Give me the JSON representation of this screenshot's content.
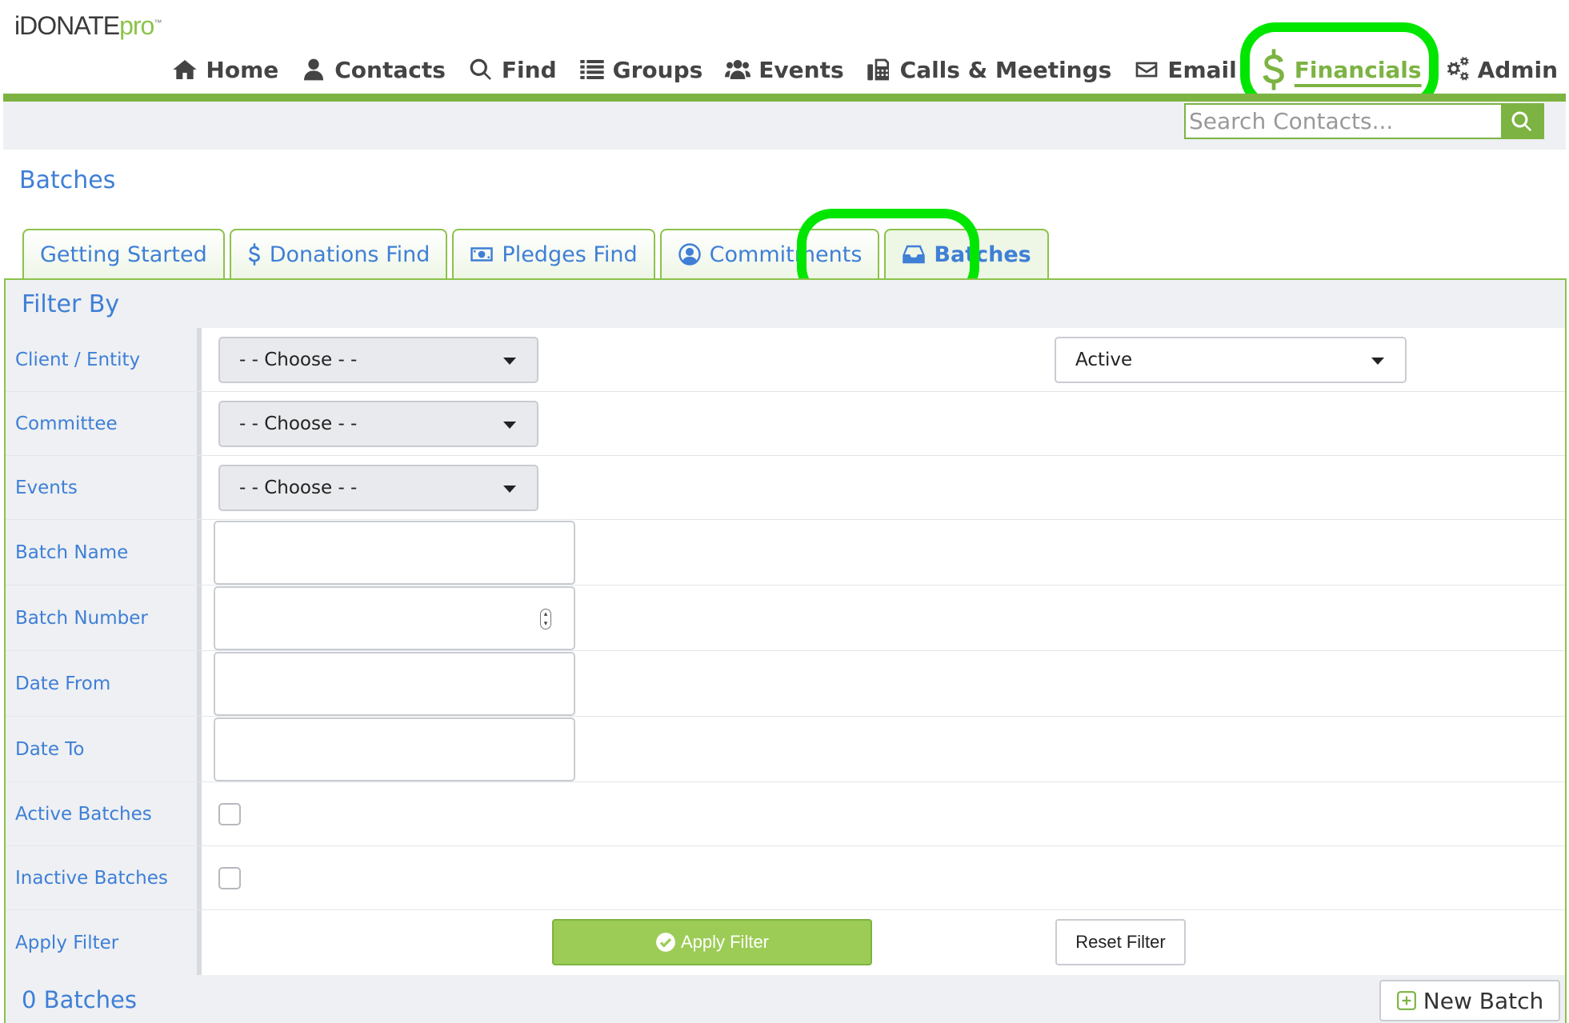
{
  "brand": {
    "logo_main": "iDONATE",
    "logo_pro": "pro",
    "logo_tm": "™"
  },
  "nav": {
    "home": "Home",
    "contacts": "Contacts",
    "find": "Find",
    "groups": "Groups",
    "events": "Events",
    "calls": "Calls & Meetings",
    "email": "Email",
    "financials": "Financials",
    "admin": "Admin"
  },
  "search": {
    "placeholder": "Search Contacts..."
  },
  "page": {
    "title": "Batches"
  },
  "tabs": [
    {
      "label": "Getting Started",
      "icon": "none"
    },
    {
      "label": "Donations Find",
      "icon": "dollar-icon"
    },
    {
      "label": "Pledges Find",
      "icon": "money-icon"
    },
    {
      "label": "Commitments",
      "icon": "user-circle-icon"
    },
    {
      "label": "Batches",
      "icon": "inbox-icon",
      "active": true
    }
  ],
  "filter": {
    "heading": "Filter By",
    "client_label": "Client / Entity",
    "client_value": "- - Choose - -",
    "status_value": "Active",
    "committee_label": "Committee",
    "committee_value": "- - Choose - -",
    "events_label": "Events",
    "events_value": "- - Choose - -",
    "batch_name_label": "Batch Name",
    "batch_name_value": "",
    "batch_number_label": "Batch Number",
    "batch_number_value": "",
    "date_from_label": "Date From",
    "date_from_value": "",
    "date_to_label": "Date To",
    "date_to_value": "",
    "active_batches_label": "Active Batches",
    "inactive_batches_label": "Inactive Batches",
    "apply_label": "Apply Filter",
    "apply_button": "Apply Filter",
    "reset_button": "Reset Filter"
  },
  "results": {
    "count_text": "0 Batches",
    "new_button": "New Batch"
  },
  "colors": {
    "accent_green": "#7cb342",
    "link_blue": "#3f7fd6",
    "highlight": "#00e600"
  }
}
